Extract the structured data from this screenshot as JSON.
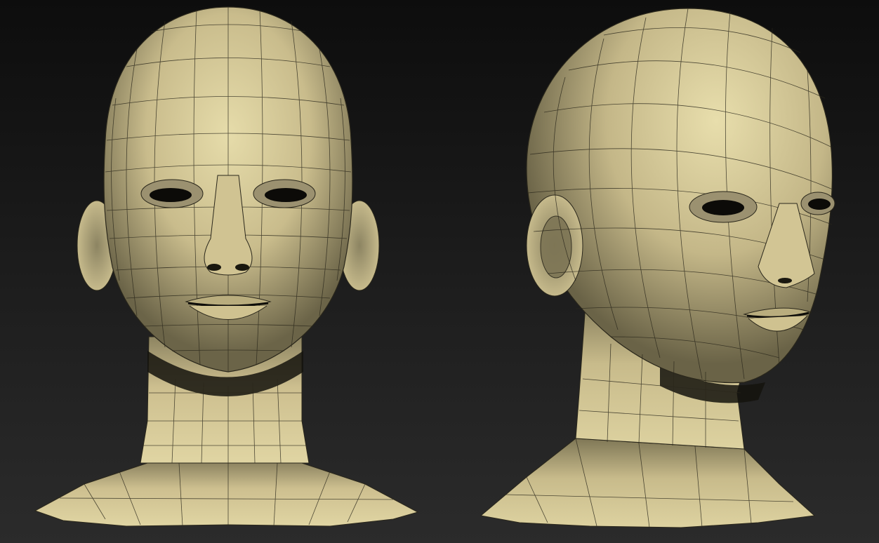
{
  "scene": {
    "views": [
      {
        "name": "front-view"
      },
      {
        "name": "three-quarter-view"
      }
    ]
  },
  "colors": {
    "background_top": "#0d0d0d",
    "background_bottom": "#2b2b2b",
    "surface_light": "#e6dcaa",
    "surface_mid": "#c4b789",
    "surface_shadow": "#5d573f",
    "wireframe": "#1e1c14"
  }
}
